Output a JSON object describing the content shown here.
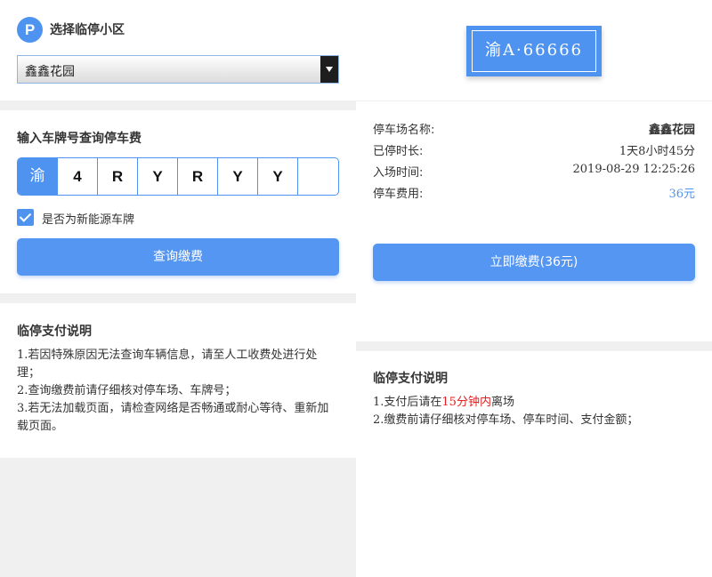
{
  "left": {
    "community": {
      "badge": "P",
      "title": "选择临停小区",
      "selected": "鑫鑫花园"
    },
    "query": {
      "title": "输入车牌号查询停车费",
      "plate_chars": [
        "渝",
        "4",
        "R",
        "Y",
        "R",
        "Y",
        "Y",
        ""
      ],
      "new_energy_label": "是否为新能源车牌",
      "new_energy_checked": true,
      "button_label": "查询缴费"
    },
    "notes": {
      "title": "临停支付说明",
      "lines": [
        "1.若因特殊原因无法查询车辆信息，请至人工收费处进行处理；",
        "2.查询缴费前请仔细核对停车场、车牌号；",
        "3.若无法加载页面，请检查网络是否畅通或耐心等待、重新加载页面。"
      ]
    }
  },
  "right": {
    "plate_display": "渝A·66666",
    "info": {
      "lot_label": "停车场名称:",
      "lot_value": "鑫鑫花园",
      "duration_label": "已停时长:",
      "duration_value": "1天8小时45分",
      "entry_label": "入场时间:",
      "entry_value": "2019-08-29 12:25:26",
      "fee_label": "停车费用:",
      "fee_value": "36元"
    },
    "pay_button_label": "立即缴费(36元)",
    "notes": {
      "title": "临停支付说明",
      "line1_prefix": "1.支付后请在",
      "line1_highlight": "15分钟内",
      "line1_suffix": "离场",
      "line2": "2.缴费前请仔细核对停车场、停车时间、支付金额；"
    }
  },
  "colors": {
    "accent": "#4f93f0",
    "highlight_red": "#e02020",
    "page_gray": "#f0f0f0"
  }
}
